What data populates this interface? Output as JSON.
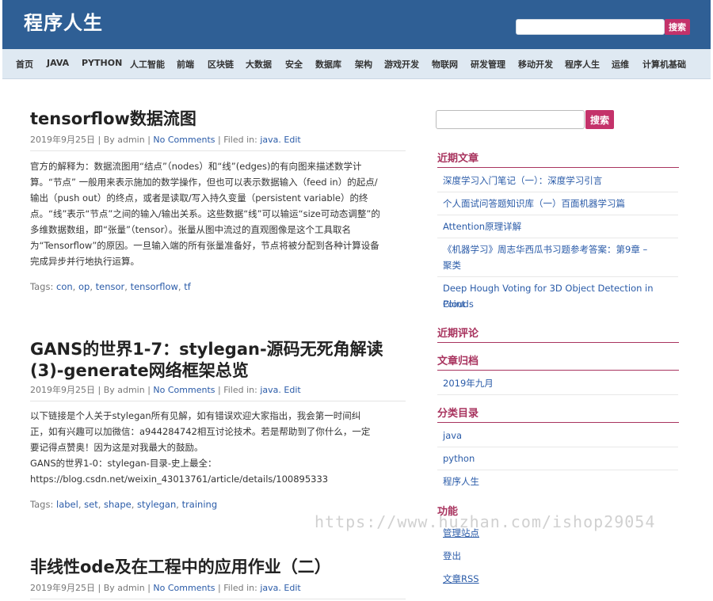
{
  "header": {
    "site_title": "程序人生",
    "search_button": "搜索"
  },
  "nav": {
    "items": [
      "首页",
      "JAVA",
      "PYTHON",
      "人工智能",
      "前端",
      "区块链",
      "大数据",
      "安全",
      "数据库",
      "架构",
      "游戏开发",
      "物联网",
      "研发管理",
      "移动开发",
      "程序人生",
      "运维",
      "计算机基础"
    ]
  },
  "posts": [
    {
      "title": "tensorflow数据流图",
      "meta": {
        "date_by": "2019年9月25日 | By admin |",
        "comments": "No Comments",
        "filed": "| Filed in:",
        "category": "java",
        "edit": "Edit"
      },
      "body": [
        "官方的解释为：数据流图用“结点”（nodes）和“线”(edges)的有向图来描述数学计",
        "算。“节点” 一般用来表示施加的数学操作，但也可以表示数据输入（feed in）的起点/",
        "输出（push out）的终点，或者是读取/写入持久变量（persistent variable）的终",
        "点。“线”表示“节点”之间的输入/输出关系。这些数据“线”可以输运“size可动态调整”的",
        "多维数据数组，即“张量”（tensor）。张量从图中流过的直观图像是这个工具取名",
        "为“Tensorflow”的原因。一旦输入端的所有张量准备好，节点将被分配到各种计算设备",
        "完成异步并行地执行运算。"
      ],
      "tags_label": "Tags:",
      "tags": [
        "con",
        "op",
        "tensor",
        "tensorflow",
        "tf"
      ]
    },
    {
      "title_line1": "GANS的世界1-7：stylegan-源码无死角解读",
      "title_line2": "(3)-generate网络框架总览",
      "meta": {
        "date_by": "2019年9月25日 | By admin |",
        "comments": "No Comments",
        "filed": "| Filed in:",
        "category": "java",
        "edit": "Edit"
      },
      "body": [
        "以下链接是个人关于stylegan所有见解，如有错误欢迎大家指出，我会第一时间纠",
        "正，如有兴趣可以加微信：a944284742相互讨论技术。若是帮助到了你什么，一定",
        "要记得点赞奥！因为这是对我最大的鼓励。",
        "GANS的世界1-0：stylegan-目录-史上最全：",
        "https://blog.csdn.net/weixin_43013761/article/details/100895333"
      ],
      "tags_label": "Tags:",
      "tags": [
        "label",
        "set",
        "shape",
        "stylegan",
        "training"
      ]
    },
    {
      "title": "非线性ode及在工程中的应用作业（二）",
      "meta": {
        "date_by": "2019年9月25日 | By admin |",
        "comments": "No Comments",
        "filed": "| Filed in:",
        "category": "java",
        "edit": "Edit"
      }
    }
  ],
  "sidebar": {
    "search_button": "搜索",
    "recent_posts_title": "近期文章",
    "recent_posts": [
      "深度学习入门笔记（一）：深度学习引言",
      "个人面试问答题知识库（一）百面机器学习篇",
      "Attention原理详解",
      "《机器学习》周志华西瓜书习题参考答案：第9章 –",
      "聚类",
      "Deep Hough Voting for 3D Object Detection in Point",
      "Clouds"
    ],
    "recent_comments_title": "近期评论",
    "archives_title": "文章归档",
    "archives": [
      "2019年九月"
    ],
    "categories_title": "分类目录",
    "categories": [
      "java",
      "python",
      "程序人生"
    ],
    "meta_title": "功能",
    "meta_links": [
      "管理站点",
      "登出",
      "文章RSS"
    ]
  },
  "watermark": "https://www.huzhan.com/ishop29054",
  "colors": {
    "header_bg": "#2f5f95",
    "nav_bg": "#dfe9f2",
    "accent": "#c4326a",
    "link": "#2a5ba8",
    "widget_title": "#a8335e"
  }
}
